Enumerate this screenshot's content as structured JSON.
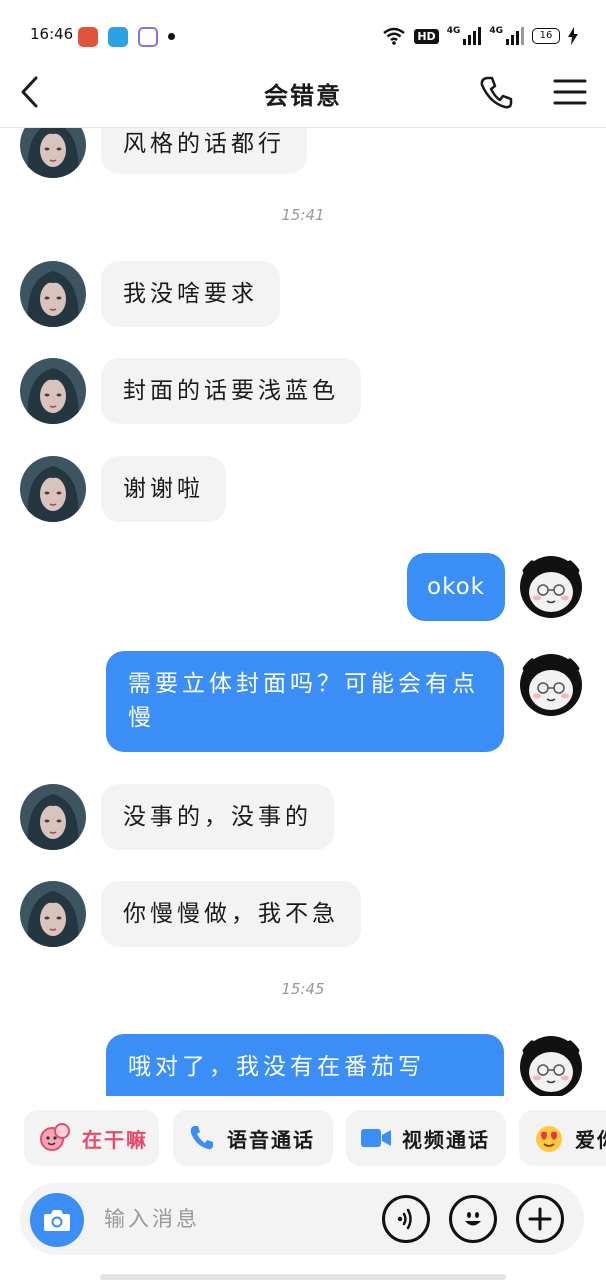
{
  "status_bar": {
    "time": "16:46",
    "network_1": "4G",
    "network_2": "4G",
    "battery": "16",
    "hd": "HD"
  },
  "header": {
    "title": "会错意"
  },
  "messages": [
    {
      "type": "in",
      "text": "风格的话都行"
    },
    {
      "type": "time",
      "text": "15:41"
    },
    {
      "type": "in",
      "text": "我没啥要求"
    },
    {
      "type": "in",
      "text": "封面的话要浅蓝色"
    },
    {
      "type": "in",
      "text": "谢谢啦"
    },
    {
      "type": "out",
      "text": "okok"
    },
    {
      "type": "out",
      "text": "需要立体封面吗？可能会有点慢"
    },
    {
      "type": "in",
      "text": "没事的，没事的"
    },
    {
      "type": "in",
      "text": "你慢慢做，我不急"
    },
    {
      "type": "time",
      "text": "15:45"
    },
    {
      "type": "out",
      "text": "哦对了，我没有在番茄写"
    }
  ],
  "quick_actions": [
    {
      "label": "在干嘛",
      "icon": "sticker-icon",
      "color": "#e84a6f"
    },
    {
      "label": "语音通话",
      "icon": "phone-icon",
      "color": "#1a1a1a"
    },
    {
      "label": "视频通话",
      "icon": "video-icon",
      "color": "#1a1a1a"
    },
    {
      "label": "爱你",
      "icon": "heart-face-icon",
      "color": "#1a1a1a"
    }
  ],
  "input": {
    "placeholder": "输入消息"
  },
  "colors": {
    "accent": "#3a8ef5",
    "bubble_in": "#f3f3f3"
  }
}
